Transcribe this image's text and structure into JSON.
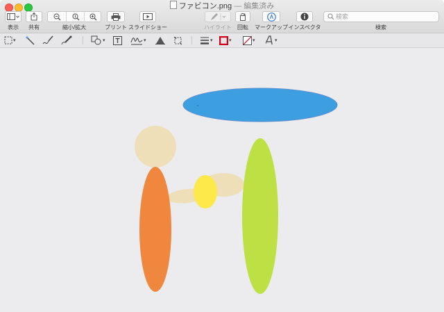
{
  "window": {
    "filename": "ファビコン.png",
    "separator": "—",
    "edited_status": "編集済み"
  },
  "toolbar": {
    "view_label": "表示",
    "share_label": "共有",
    "zoom_label": "縮小/拡大",
    "print_label": "プリント",
    "slideshow_label": "スライドショー",
    "highlight_label": "ハイライト",
    "rotate_label": "回転",
    "markup_label": "マークアップ",
    "inspector_label": "インスペクタ",
    "search_label": "検索"
  },
  "search": {
    "placeholder": "検索"
  },
  "markup_tools": [
    "selection-tool",
    "instant-alpha-tool",
    "sketch-tool",
    "draw-tool",
    "shapes-tool",
    "text-tool",
    "sign-tool",
    "adjust-color-tool",
    "adjust-size-tool",
    "line-style-tool",
    "border-color-tool",
    "fill-color-tool",
    "text-style-tool"
  ],
  "colors": {
    "accent_blue": "#3d9de0",
    "ellipse_blue": "#3e9fe0",
    "ellipse_green": "#bde045",
    "ellipse_orange": "#f0873e",
    "skin": "#efdfb9",
    "yellow": "#fde94a",
    "border_color_swatch": "#d0021b"
  }
}
